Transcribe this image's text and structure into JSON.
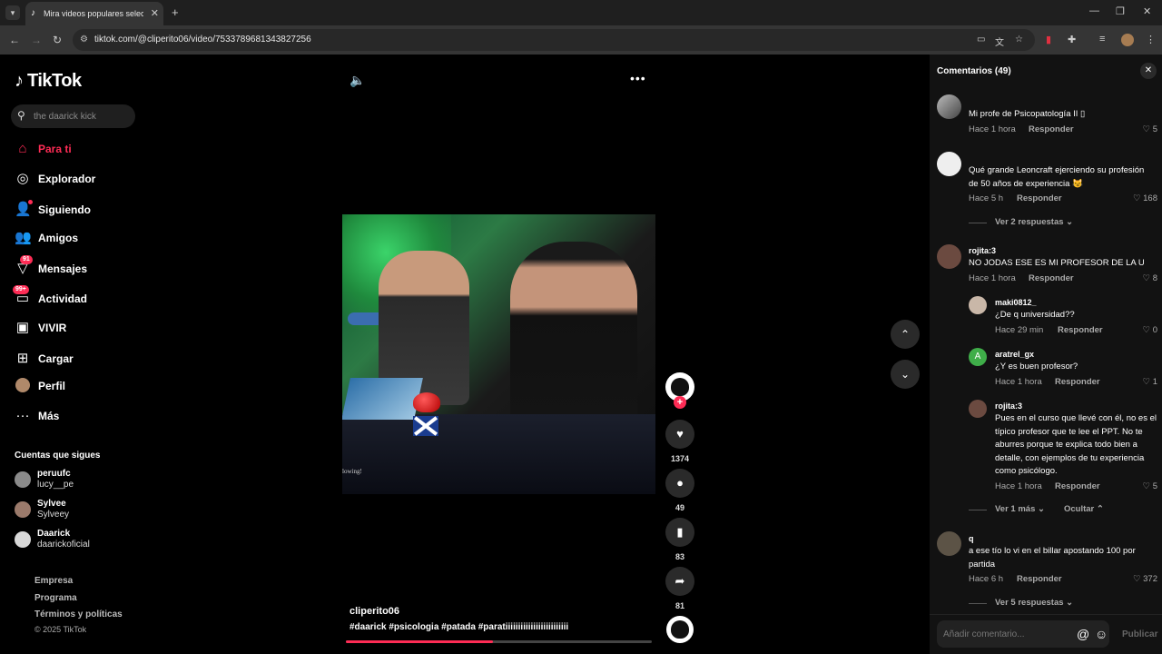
{
  "browser": {
    "tab_title": "Mira videos populares seleccionados",
    "url": "tiktok.com/@cliperito06/video/7533789681343827256"
  },
  "sidebar": {
    "logo": "TikTok",
    "search_placeholder": "the daarick kick",
    "nav": [
      {
        "label": "Para ti",
        "icon": "home-icon",
        "active": true
      },
      {
        "label": "Explorador",
        "icon": "compass-icon"
      },
      {
        "label": "Siguiendo",
        "icon": "following-icon"
      },
      {
        "label": "Amigos",
        "icon": "friends-icon"
      },
      {
        "label": "Mensajes",
        "icon": "messages-icon",
        "badge": "91"
      },
      {
        "label": "Actividad",
        "icon": "activity-icon",
        "badge": "99+"
      },
      {
        "label": "VIVIR",
        "icon": "live-icon"
      },
      {
        "label": "Cargar",
        "icon": "upload-icon"
      },
      {
        "label": "Perfil",
        "icon": "profile-icon"
      },
      {
        "label": "Más",
        "icon": "more-icon"
      }
    ],
    "following_title": "Cuentas que sigues",
    "following": [
      {
        "name": "peruufc",
        "user": "lucy__pe"
      },
      {
        "name": "Sylvee",
        "user": "Sylveey"
      },
      {
        "name": "Daarick",
        "user": "daarickoficial"
      }
    ],
    "footer": [
      "Empresa",
      "Programa",
      "Términos y políticas"
    ],
    "copyright": "© 2025 TikTok"
  },
  "video": {
    "watermark": "lowing!",
    "author": "cliperito06",
    "hashtags": "#daarick  #psicologia  #patada  #paratiiiiiiiiiiiiiiiiiiiiiiiii",
    "progress": 0.48,
    "likes": "1374",
    "comments": "49",
    "saves": "83",
    "shares": "81"
  },
  "comments_panel": {
    "title": "Comentarios (49)",
    "reply_label": "Responder",
    "input_placeholder": "Añadir comentario...",
    "publish_label": "Publicar",
    "comments": [
      {
        "author": "",
        "text": "Mi profe de Psicopatología II ▯",
        "time": "Hace 1 hora",
        "likes": "5"
      },
      {
        "author": "",
        "text": "Qué grande Leoncraft ejerciendo su profesión de 50 años de experiencia 😼",
        "time": "Hace 5 h",
        "likes": "168",
        "more": "Ver 2 respuestas"
      },
      {
        "author": "rojita:3",
        "text": "NO JODAS ESE ES MI PROFESOR DE LA U",
        "time": "Hace 1 hora",
        "likes": "8"
      },
      {
        "author": "maki0812_",
        "text": "¿De q universidad??",
        "time": "Hace 29 min",
        "likes": "0"
      },
      {
        "author": "aratrel_gx",
        "text": "¿Y es buen profesor?",
        "time": "Hace 1 hora",
        "likes": "1",
        "initial": "A"
      },
      {
        "author": "rojita:3",
        "text": "Pues en el curso que llevé con él, no es el típico profesor que te lee el PPT. No te aburres porque te explica todo bien a detalle, con ejemplos de tu experiencia como psicólogo.",
        "time": "Hace 1 hora",
        "likes": "5",
        "more": "Ver 1 más",
        "hide": "Ocultar"
      },
      {
        "author": "q",
        "text": "a ese tío lo vi en el billar apostando 100 por partida",
        "time": "Hace 6 h",
        "likes": "372",
        "more": "Ver 5 respuestas"
      }
    ]
  },
  "colors": {
    "accent": "#fe2c55",
    "panel_bg": "#121212"
  }
}
